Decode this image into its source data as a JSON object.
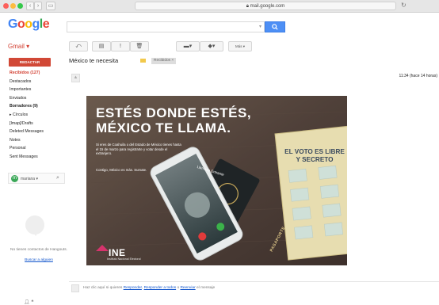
{
  "browser": {
    "url": "mail.google.com",
    "icons": [
      "back-icon",
      "forward-icon",
      "sidebar-icon",
      "reload-icon"
    ]
  },
  "header": {
    "logo": "Google",
    "logo_colors": [
      "#4285f4",
      "#ea4335",
      "#fbbc05",
      "#4285f4",
      "#34a853",
      "#ea4335"
    ],
    "search_value": ""
  },
  "toolbar": {
    "gmail_label": "Gmail ▾",
    "more_label": "Más ▾",
    "icons": [
      "reply-icon",
      "archive-icon",
      "report-spam-icon",
      "delete-icon",
      "folder-icon",
      "label-icon"
    ]
  },
  "sidebar": {
    "compose_label": "REDACTAR",
    "items": [
      {
        "label": "Recibidos (127)",
        "state": "active"
      },
      {
        "label": "Destacados",
        "state": ""
      },
      {
        "label": "Importantes",
        "state": ""
      },
      {
        "label": "Enviados",
        "state": ""
      },
      {
        "label": "Borradores (9)",
        "state": "bold"
      },
      {
        "label": "▸ Círculos",
        "state": ""
      },
      {
        "label": "[Imap]/Drafts",
        "state": ""
      },
      {
        "label": "Deleted Messages",
        "state": ""
      },
      {
        "label": "Notes",
        "state": ""
      },
      {
        "label": "Personal",
        "state": ""
      },
      {
        "label": "Sent Messages",
        "state": ""
      }
    ],
    "chat_user": "mariana ▾",
    "no_contacts": "No tienes contactos de Hangouts.",
    "find_link": "Buscar a alguien"
  },
  "message": {
    "subject": "México te necesita",
    "label": "Recibidos ×",
    "time": "11:34 (hace 14 horas)"
  },
  "poster": {
    "headline_1": "ESTÉS DONDE ESTÉS,",
    "headline_2": "MÉXICO TE LLAMA.",
    "body": "Si eres de Coahuila o del Estado de México tienes hasta el 15 de marzo para registrarte y votar desde el extranjero.",
    "footer": "Contigo, México es más. Sumate.",
    "ballot_title": "EL VOTO ES LIBRE Y SECRETO",
    "call_label": "Llamada Entrante",
    "passport_label": "PASAPORTE",
    "brand": "INE",
    "brand_sub": "Instituto Nacional Electoral"
  },
  "reply": {
    "prefix": "Haz clic aquí si quieres",
    "reply_link": "Responder",
    "sep1": ",",
    "reply_all_link": "Responder a todos",
    "sep2": "o",
    "forward_link": "Reenviar",
    "suffix": "el mensaje"
  }
}
